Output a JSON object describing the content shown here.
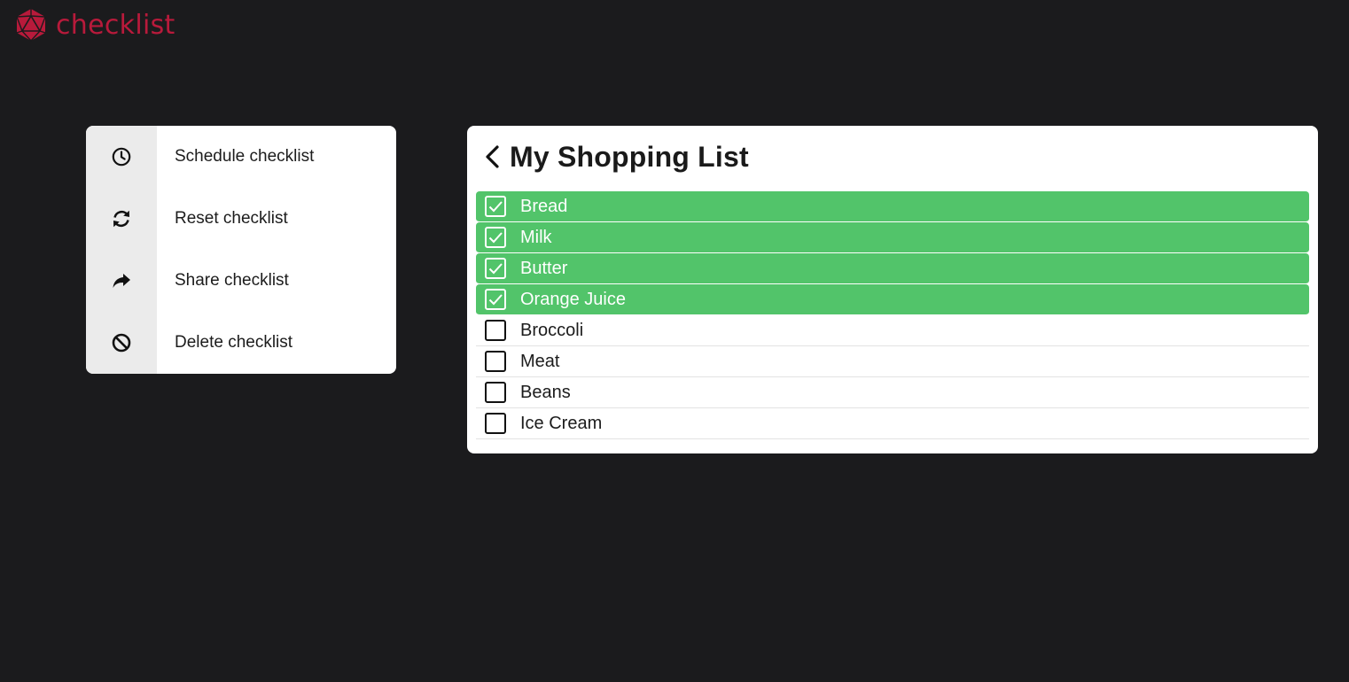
{
  "app": {
    "brand_name": "checklist",
    "logo_icon": "d20-icon",
    "brand_color": "#b81a3b"
  },
  "menu": {
    "items": [
      {
        "label": "Schedule checklist",
        "icon": "clock-icon"
      },
      {
        "label": "Reset checklist",
        "icon": "refresh-icon"
      },
      {
        "label": "Share checklist",
        "icon": "share-icon"
      },
      {
        "label": "Delete checklist",
        "icon": "ban-icon"
      }
    ]
  },
  "checklist": {
    "title": "My Shopping List",
    "back_icon": "chevron-left-icon",
    "checked_color": "#52c46a",
    "items": [
      {
        "label": "Bread",
        "checked": true
      },
      {
        "label": "Milk",
        "checked": true
      },
      {
        "label": "Butter",
        "checked": true
      },
      {
        "label": "Orange Juice",
        "checked": true
      },
      {
        "label": "Broccoli",
        "checked": false
      },
      {
        "label": "Meat",
        "checked": false
      },
      {
        "label": "Beans",
        "checked": false
      },
      {
        "label": "Ice Cream",
        "checked": false
      }
    ]
  }
}
